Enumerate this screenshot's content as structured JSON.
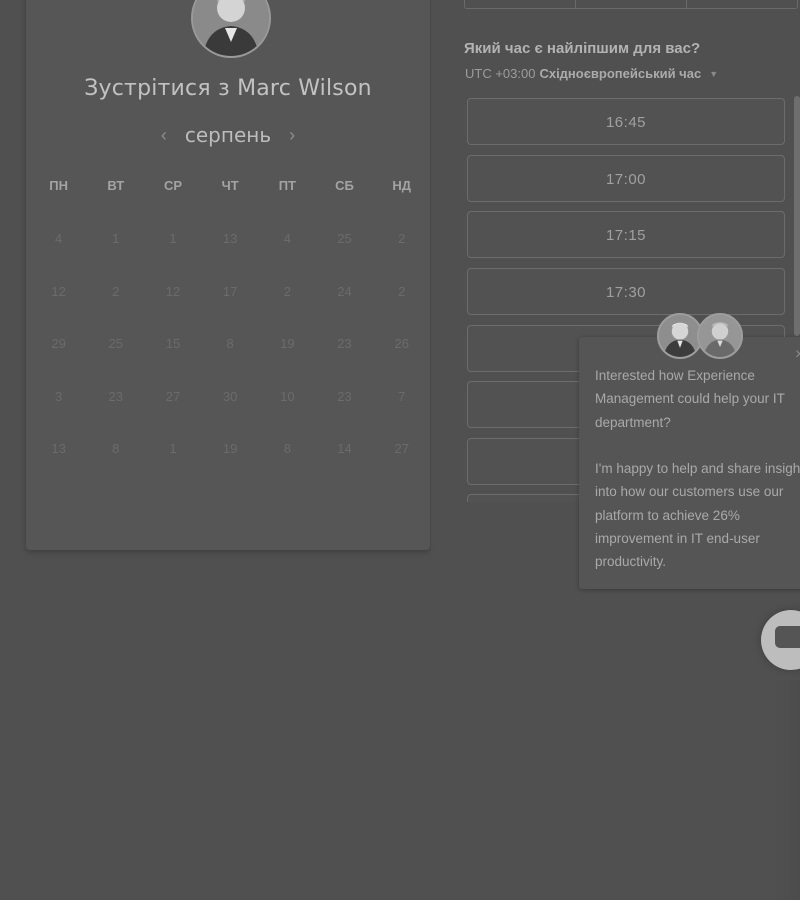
{
  "scheduler": {
    "title": "Зустрітися з Marc Wilson",
    "month": "серпень",
    "prev_symbol": "‹",
    "next_symbol": "›",
    "weekdays": [
      "ПН",
      "ВТ",
      "СР",
      "ЧТ",
      "ПТ",
      "СБ",
      "НД"
    ],
    "days": [
      [
        "4",
        "1",
        "1",
        "13",
        "4",
        "25",
        "2"
      ],
      [
        "12",
        "2",
        "12",
        "17",
        "2",
        "24",
        "2"
      ],
      [
        "29",
        "25",
        "15",
        "8",
        "19",
        "23",
        "26"
      ],
      [
        "3",
        "23",
        "27",
        "30",
        "10",
        "23",
        "7"
      ],
      [
        "13",
        "8",
        "1",
        "19",
        "8",
        "14",
        "27"
      ]
    ]
  },
  "time_panel": {
    "question": "Який час є найліпшим для вас?",
    "tz_offset": "UTC +03:00",
    "tz_name": "Східноєвропейський час",
    "slots": [
      "16:45",
      "17:00",
      "17:15",
      "17:30",
      "",
      "",
      "",
      ""
    ]
  },
  "chat": {
    "paragraph1": "Interested how Experience Management could help your IT department?",
    "paragraph2": "I'm happy to help and share insight into how our customers use our platform to achieve 26% improvement in IT end-user productivity.",
    "close_symbol": "×"
  },
  "icons": {
    "avatar_main": "person-photo-icon",
    "chat_avatars": [
      "person-photo-icon",
      "person-photo-icon"
    ],
    "launcher": "chat-bubble-icon",
    "tz_dropdown": "caret-down-icon"
  },
  "colors": {
    "overlay_background": "#505050",
    "card": "#565656",
    "text_light": "#c2c2c2",
    "slot_border": "#6c6c6c"
  }
}
